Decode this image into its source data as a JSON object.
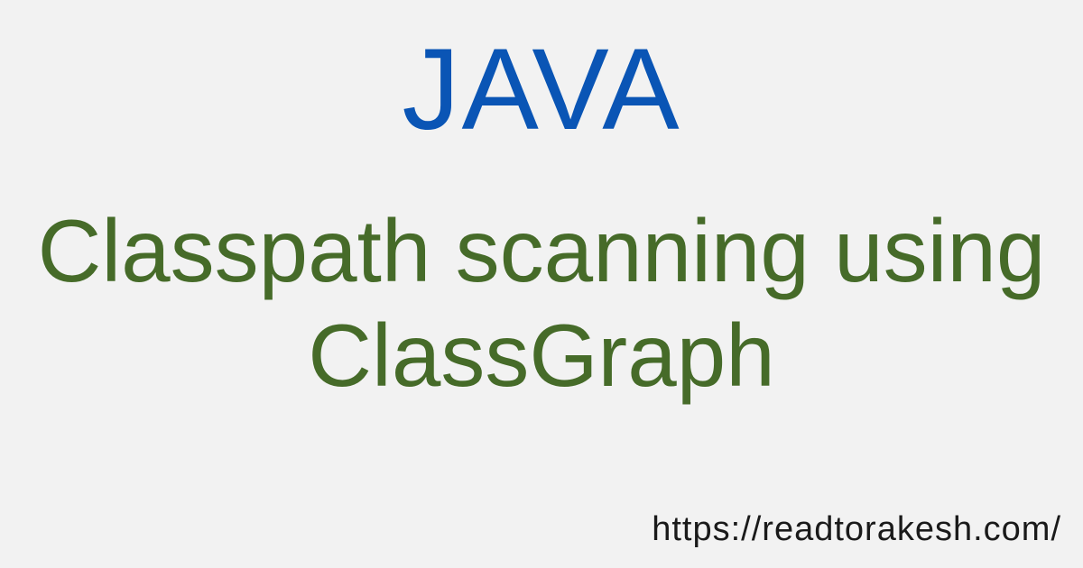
{
  "category": "JAVA",
  "title": {
    "line1": "Classpath scanning using",
    "line2": "ClassGraph"
  },
  "site_url": "https://readtorakesh.com/",
  "colors": {
    "background": "#f2f2f2",
    "category": "#0a55b5",
    "title": "#466b29",
    "url": "#1a1a1a"
  }
}
